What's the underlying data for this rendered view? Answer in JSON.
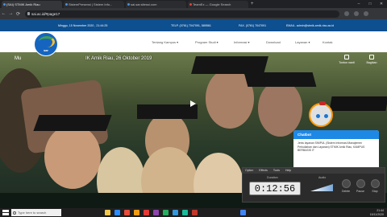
{
  "browser": {
    "tabs": [
      {
        "label": "(SAI) STMIK Amik Riau",
        "active": true
      },
      {
        "label": "SistemPresensi | Sistem Info...",
        "active": false
      },
      {
        "label": "sai.sar.sitessi.com",
        "active": false
      },
      {
        "label": "TeamEx — Google Search",
        "active": false
      }
    ],
    "new_tab": "+",
    "window_controls": [
      "–",
      "□",
      "✕"
    ],
    "address": "sai.ac.id/#page17"
  },
  "site": {
    "date": "Minggu, 15 November 2020 , 21:44:25",
    "phone": "TELP. (0761) 7047091, 589561",
    "fax": "FAX. (0761) 7047091",
    "email": "EMAIL. admin@stmik-amik-riau.ac.id",
    "logo_text": "sar",
    "menu": [
      "Tentang Kampus ▾",
      "Program Studi ▾",
      "Informasi ▾",
      "Download",
      "Layanan ▾",
      "Kontak"
    ]
  },
  "video": {
    "title_prefix": "Mu",
    "title": "IK Amik Riau, 26 Oktober 2019",
    "watch_later": "Tonton nanti",
    "share": "Bagikan"
  },
  "chat": {
    "title": "Chatbot",
    "body": "Jenis layanan SIMPUL (Sistem Informasi Manajemen Perkuliahan dan Layanan) STMIK Amik Riau, KAMPUS BERBASIS IT"
  },
  "timer": {
    "menu": [
      "Option",
      "Effects",
      "Tools",
      "Help"
    ],
    "duration_label": "Duration",
    "audio_label": "Audio",
    "time": "0:12:56",
    "controls": [
      "Delete",
      "Pause",
      "Stop"
    ]
  },
  "taskbar": {
    "search_placeholder": "Type here to search",
    "tray_time": "21:44",
    "tray_date": "15/11/2020"
  },
  "colors": {
    "site_header": "#0d4f8f",
    "chat_header": "#1e88e5",
    "taskbar": "#1f1f1f"
  }
}
